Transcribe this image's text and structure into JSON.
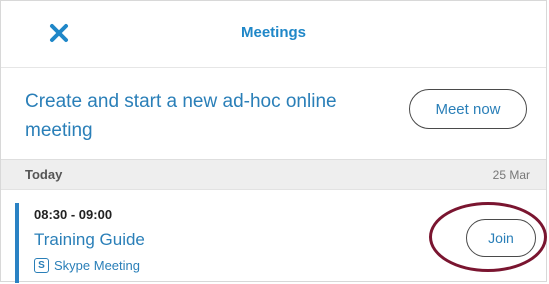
{
  "header": {
    "title": "Meetings",
    "close_icon": "close-icon"
  },
  "adhoc": {
    "description": "Create and start a new ad-hoc online meeting",
    "meet_now_label": "Meet now"
  },
  "section": {
    "day": "Today",
    "date": "25 Mar"
  },
  "meeting": {
    "time": "08:30 - 09:00",
    "title": "Training Guide",
    "type_label": "Skype Meeting",
    "type_icon": "skype-icon",
    "join_label": "Join"
  },
  "colors": {
    "accent": "#1f87c8",
    "text_blue": "#2a7fb8",
    "highlight": "#7a1530",
    "section_bg": "#eeeeee"
  }
}
